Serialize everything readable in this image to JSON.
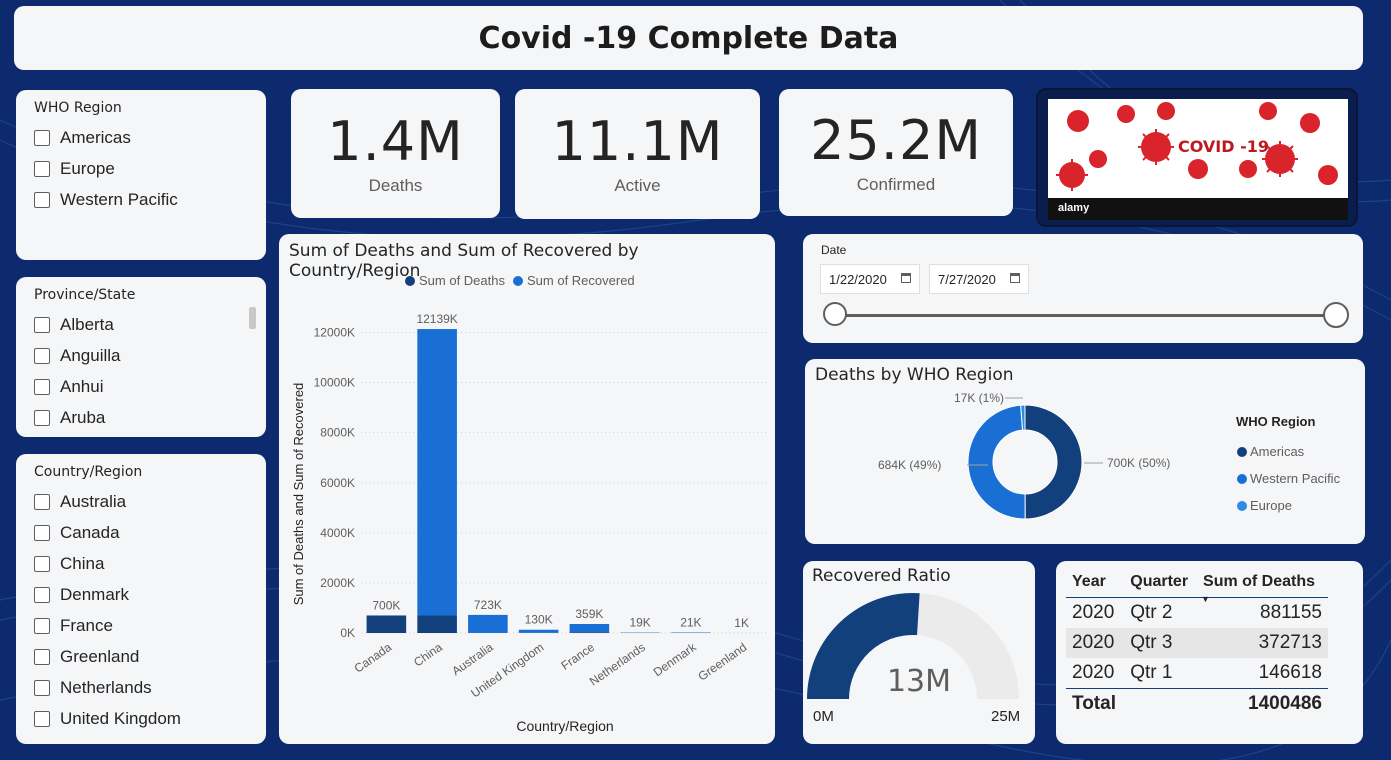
{
  "title": "Covid -19 Complete Data",
  "slicers": {
    "who_region": {
      "title": "WHO Region",
      "items": [
        "Americas",
        "Europe",
        "Western Pacific"
      ]
    },
    "province_state": {
      "title": "Province/State",
      "items": [
        "Alberta",
        "Anguilla",
        "Anhui",
        "Aruba"
      ]
    },
    "country_region": {
      "title": "Country/Region",
      "items": [
        "Australia",
        "Canada",
        "China",
        "Denmark",
        "France",
        "Greenland",
        "Netherlands",
        "United Kingdom"
      ]
    }
  },
  "kpis": [
    {
      "value": "1.4M",
      "label": "Deaths"
    },
    {
      "value": "11.1M",
      "label": "Active"
    },
    {
      "value": "25.2M",
      "label": "Confirmed"
    }
  ],
  "image": {
    "text": "COVID -19",
    "brand": "alamy"
  },
  "bar_chart": {
    "title": "Sum of Deaths and Sum of Recovered by Country/Region",
    "legend": [
      "Sum of Deaths",
      "Sum of Recovered"
    ],
    "ylabel": "Sum of Deaths and Sum of Recovered",
    "xlabel": "Country/Region",
    "yticks": [
      "0K",
      "2000K",
      "4000K",
      "6000K",
      "8000K",
      "10000K",
      "12000K"
    ]
  },
  "date_slicer": {
    "label": "Date",
    "start": "1/22/2020",
    "end": "7/27/2020"
  },
  "donut": {
    "title": "Deaths by WHO Region",
    "legend_title": "WHO Region",
    "labels": [
      "700K (50%)",
      "684K (49%)",
      "17K (1%)"
    ]
  },
  "gauge": {
    "title": "Recovered Ratio",
    "value_label": "13M",
    "min_label": "0M",
    "max_label": "25M",
    "value": 13,
    "min": 0,
    "max": 25
  },
  "matrix": {
    "headers": [
      "Year",
      "Quarter",
      "Sum of Deaths"
    ],
    "rows": [
      {
        "year": "2020",
        "quarter": "Qtr 2",
        "deaths": "881155"
      },
      {
        "year": "2020",
        "quarter": "Qtr 3",
        "deaths": "372713"
      },
      {
        "year": "2020",
        "quarter": "Qtr 1",
        "deaths": "146618"
      }
    ],
    "total_label": "Total",
    "total_value": "1400486"
  },
  "colors": {
    "background": "#0d2a6e",
    "deaths": "#12407c",
    "recovered": "#1a6fd4",
    "americas": "#12407c",
    "western_pacific": "#1a6fd4",
    "europe": "#2f8be6",
    "gauge_fill": "#12407c",
    "gauge_track": "#ebebeb"
  },
  "chart_data": [
    {
      "type": "bar",
      "title": "Sum of Deaths and Sum of Recovered by Country/Region",
      "categories": [
        "Canada",
        "China",
        "Australia",
        "United Kingdom",
        "France",
        "Netherlands",
        "Denmark",
        "Greenland"
      ],
      "series": [
        {
          "name": "Sum of Deaths",
          "values": [
            700,
            700,
            2,
            8,
            30,
            6,
            1,
            0
          ]
        },
        {
          "name": "Sum of Recovered",
          "values": [
            0,
            11439,
            721,
            122,
            329,
            13,
            20,
            1
          ]
        }
      ],
      "totals_labels": [
        "700K",
        "12139K",
        "723K",
        "130K",
        "359K",
        "19K",
        "21K",
        "1K"
      ],
      "xlabel": "Country/Region",
      "ylabel": "Sum of Deaths and Sum of Recovered",
      "ylim": [
        0,
        12500
      ],
      "stacked": true,
      "legend": "top",
      "grid": true
    },
    {
      "type": "pie",
      "title": "Deaths by WHO Region",
      "categories": [
        "Americas",
        "Western Pacific",
        "Europe"
      ],
      "values": [
        700,
        684,
        17
      ],
      "value_labels": [
        "700K (50%)",
        "684K (49%)",
        "17K (1%)"
      ],
      "donut": true,
      "legend": "right"
    }
  ]
}
